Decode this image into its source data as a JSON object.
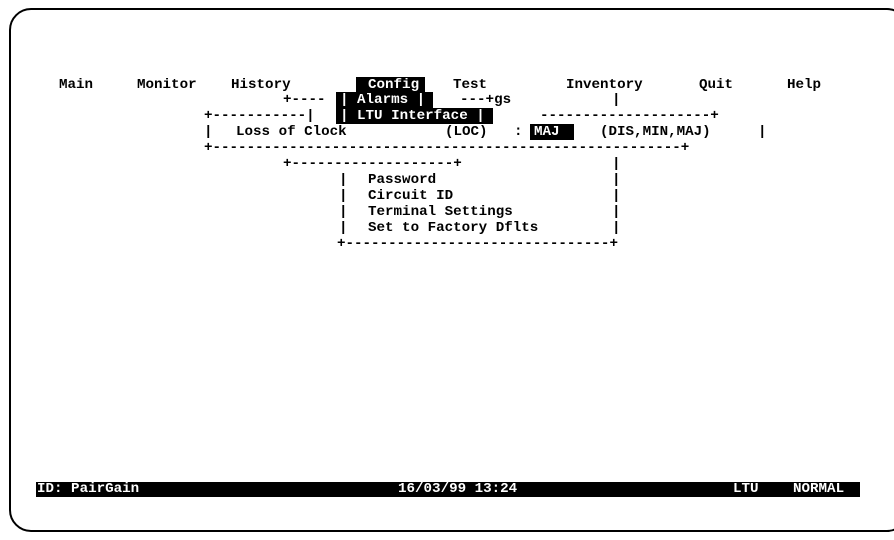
{
  "menu": {
    "items": [
      "Main",
      "Monitor",
      "History",
      "Config",
      "Test",
      "Inventory",
      "Quit",
      "Help"
    ],
    "active": "Config"
  },
  "config_menu": {
    "alarms": "Alarms",
    "ltu_interface": "LTU Interface",
    "overlap_fragment": "gs"
  },
  "ltu_dialog": {
    "label": "Loss of Clock",
    "abbrev": "(LOC)",
    "separator": ":",
    "value": "MAJ",
    "options": "(DIS,MIN,MAJ)"
  },
  "sub_menu": {
    "items": [
      "Password",
      "Circuit ID",
      "Terminal Settings",
      "Set to Factory Dflts"
    ]
  },
  "status": {
    "id": "ID: PairGain",
    "datetime": "16/03/99 13:24",
    "unit": "LTU",
    "state": "NORMAL"
  }
}
